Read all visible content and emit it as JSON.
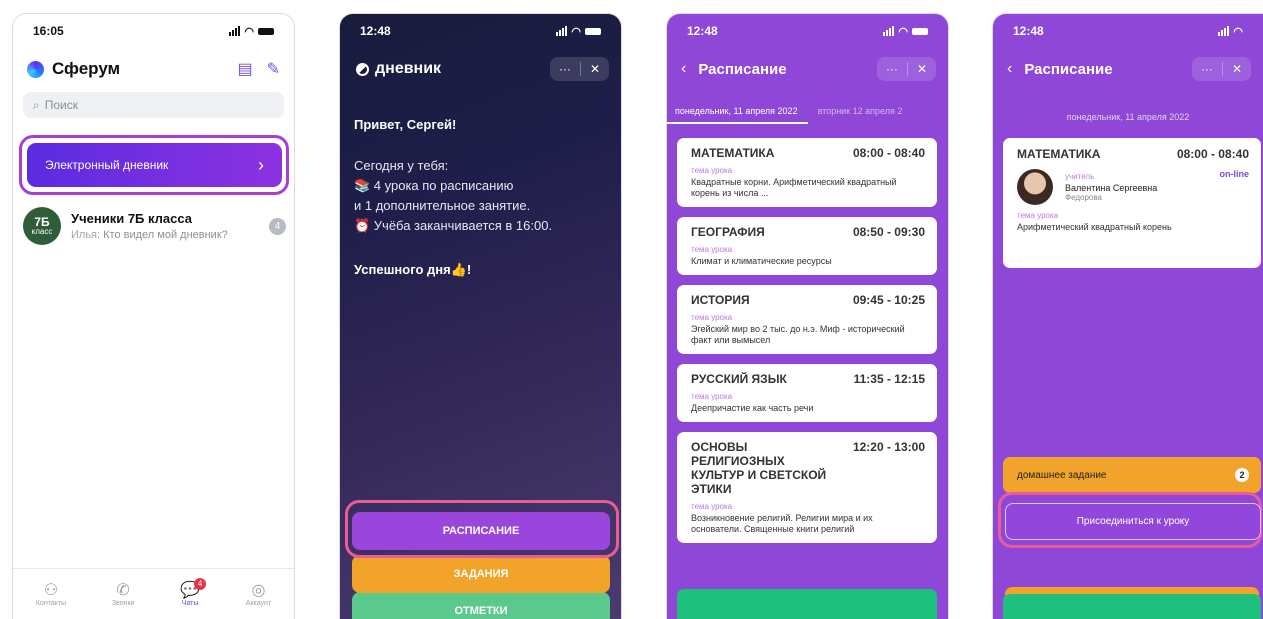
{
  "phone1": {
    "time": "16:05",
    "app_title": "Сферум",
    "search_placeholder": "Поиск",
    "diary_label": "Электронный дневник",
    "chat": {
      "avatar_num": "7Б",
      "avatar_word": "класс",
      "name": "Ученики 7Б класса",
      "sender": "Илья:",
      "message": "Кто видел мой дневник?",
      "unread": "4"
    },
    "tabs": [
      {
        "label": "Контакты",
        "icon": "contacts-icon"
      },
      {
        "label": "Звонки",
        "icon": "phone-icon"
      },
      {
        "label": "Чаты",
        "icon": "chat-icon",
        "badge": "4"
      },
      {
        "label": "Аккаунт",
        "icon": "account-icon"
      }
    ]
  },
  "phone2": {
    "time": "12:48",
    "title": "дневник",
    "more": "···",
    "close": "✕",
    "greeting": "Привет, Сергей!",
    "line1": "Сегодня у тебя:",
    "line2": "📚 4 урока по расписанию",
    "line3": "и 1 дополнительное занятие.",
    "line4": "⏰ Учёба заканчивается в 16:00.",
    "wish": "Успешного дня👍!",
    "buttons": {
      "schedule": "РАСПИСАНИЕ",
      "tasks": "ЗАДАНИЯ",
      "marks": "ОТМЕТКИ"
    }
  },
  "phone3": {
    "time": "12:48",
    "title": "Расписание",
    "date_active": "понедельник, 11 апреля 2022",
    "date_next": "вторник 12 апреля 2",
    "topic_label": "тема урока",
    "lessons": [
      {
        "name": "МАТЕМАТИКА",
        "time": "08:00 - 08:40",
        "desc": "Квадратные корни. Арифметический квадратный корень из числа ..."
      },
      {
        "name": "ГЕОГРАФИЯ",
        "time": "08:50 - 09:30",
        "desc": "Климат и климатические ресурсы"
      },
      {
        "name": "ИСТОРИЯ",
        "time": "09:45 - 10:25",
        "desc": "Эгейский мир во 2 тыс. до н.э. Миф - исторический  факт или вымысел"
      },
      {
        "name": "РУССКИЙ ЯЗЫК",
        "time": "11:35 - 12:15",
        "desc": "Деепричастие как часть речи"
      },
      {
        "name": "ОСНОВЫ РЕЛИГИОЗНЫХ КУЛЬТУР И СВЕТСКОЙ ЭТИКИ",
        "time": "12:20 - 13:00",
        "desc": "Возникновение религий. Религии мира и их основатели. Священные книги религий"
      }
    ]
  },
  "phone4": {
    "time": "12:48",
    "title": "Расписание",
    "date": "понедельник, 11 апреля 2022",
    "lesson": "МАТЕМАТИКА",
    "lesson_time": "08:00 - 08:40",
    "teacher_role": "учитель",
    "teacher_name": "Валентина Сергеевна",
    "teacher_surname": "Федорова",
    "online": "on-line",
    "topic_label": "тема урока",
    "topic": "Арифметический квадратный корень",
    "homework_label": "домашнее задание",
    "homework_count": "2",
    "join_label": "Присоединиться к уроку"
  }
}
